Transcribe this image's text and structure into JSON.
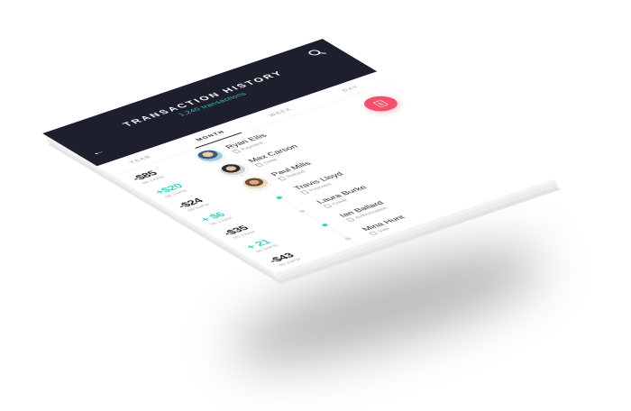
{
  "header": {
    "title": "TRANSACTION HISTORY",
    "subtitle": "1,240 transactions",
    "back_icon": "back-arrow-icon",
    "search_icon": "search-icon"
  },
  "tabs": [
    {
      "label": "YEAR",
      "active": false
    },
    {
      "label": "MONTH",
      "active": true
    },
    {
      "label": "WEEK",
      "active": false
    },
    {
      "label": "DAY",
      "active": false
    }
  ],
  "transactions": [
    {
      "amount": "-$85",
      "time": "09:54AM",
      "name": "Ryan Ellis",
      "type": "Payment",
      "positive": false
    },
    {
      "amount": "+$20",
      "time": "09:25PM",
      "name": "Max Carson",
      "type": "Debit",
      "positive": true
    },
    {
      "amount": "-$24",
      "time": "09:03PM",
      "name": "Paul Mills",
      "type": "Refund",
      "positive": false
    },
    {
      "amount": "+ $6",
      "time": "05:13AM",
      "name": "Travis Lloyd",
      "type": "Payment",
      "positive": true
    },
    {
      "amount": "-$35",
      "time": "05:13AM",
      "name": "Laura Burke",
      "type": "Credit",
      "positive": false
    },
    {
      "amount": "+ 21",
      "time": "05:40PM",
      "name": "Ian Ballard",
      "type": "Authorisation",
      "positive": true
    },
    {
      "amount": "-$43",
      "time": "05:43PM",
      "name": "Mina Hunt",
      "type": "Sale",
      "positive": false
    }
  ],
  "fab": {
    "icon": "receipt-icon"
  },
  "colors": {
    "header_bg": "#1e1f2d",
    "accent_teal": "#3ad2c7",
    "fab_pink": "#f2506d"
  }
}
